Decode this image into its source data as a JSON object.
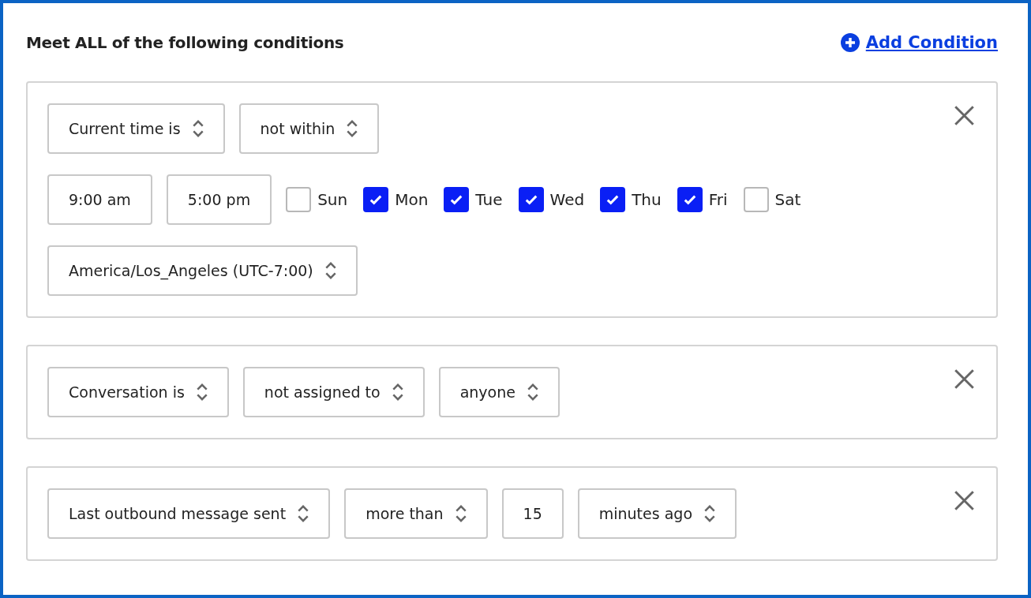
{
  "heading": "Meet ALL of the following conditions",
  "add_condition": {
    "label": "Add Condition"
  },
  "conditions": [
    {
      "rows": [
        [
          {
            "kind": "select",
            "value": "Current time is"
          },
          {
            "kind": "select",
            "value": "not within"
          }
        ],
        [
          {
            "kind": "input",
            "value": "9:00 am"
          },
          {
            "kind": "input",
            "value": "5:00 pm"
          },
          {
            "kind": "days",
            "days": [
              {
                "label": "Sun",
                "checked": false
              },
              {
                "label": "Mon",
                "checked": true
              },
              {
                "label": "Tue",
                "checked": true
              },
              {
                "label": "Wed",
                "checked": true
              },
              {
                "label": "Thu",
                "checked": true
              },
              {
                "label": "Fri",
                "checked": true
              },
              {
                "label": "Sat",
                "checked": false
              }
            ]
          }
        ],
        [
          {
            "kind": "select",
            "value": "America/Los_Angeles (UTC-7:00)"
          }
        ]
      ]
    },
    {
      "rows": [
        [
          {
            "kind": "select",
            "value": "Conversation is"
          },
          {
            "kind": "select",
            "value": "not assigned to"
          },
          {
            "kind": "select",
            "value": "anyone"
          }
        ]
      ]
    },
    {
      "rows": [
        [
          {
            "kind": "select",
            "value": "Last outbound message sent"
          },
          {
            "kind": "select",
            "value": "more than"
          },
          {
            "kind": "input",
            "value": "15"
          },
          {
            "kind": "select",
            "value": "minutes ago"
          }
        ]
      ]
    }
  ]
}
